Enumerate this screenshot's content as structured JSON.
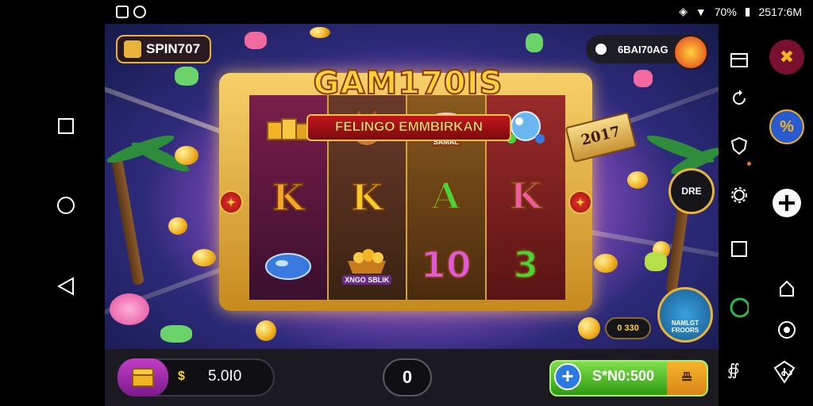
{
  "status_bar": {
    "battery": "70%",
    "time": "2517:6M",
    "icons": [
      "screenshot-icon",
      "recorder-icon",
      "vpn-icon",
      "wifi-icon",
      "battery-icon"
    ]
  },
  "game": {
    "spin_badge": "SPIN707",
    "title": "GAM170IS",
    "subtitle": "FELINGO EMMBIRKAN",
    "year_flag": "2017",
    "balance": "6BAI70AG",
    "dial_label": "DRE",
    "bonus_label": "NAMLGT\nFROORS",
    "mini_counter": "0 330",
    "reels": [
      {
        "top": "gold-bars",
        "middle": "K",
        "bottom": "blue-gem"
      },
      {
        "top": "dog",
        "middle": "K",
        "bottom": "gold-basket"
      },
      {
        "top": "pink-gem",
        "top_caption": "SAMAL",
        "middle": "A",
        "bottom": "10"
      },
      {
        "top": "crystal-ball",
        "middle": "K",
        "bottom": "3"
      }
    ],
    "basket_caption": "XNGO SBLIK"
  },
  "controls": {
    "bet_value": "5.0­0",
    "bet_display": "5.0I0",
    "bet_symbol": "$",
    "autoplay_label": "0",
    "spin_label": "S*N0:500",
    "spin_extra": "⇯"
  },
  "colors": {
    "frame_gold": "#e8b53a",
    "spin_green": "#2f9a14",
    "chest_purple": "#a02ab0"
  }
}
